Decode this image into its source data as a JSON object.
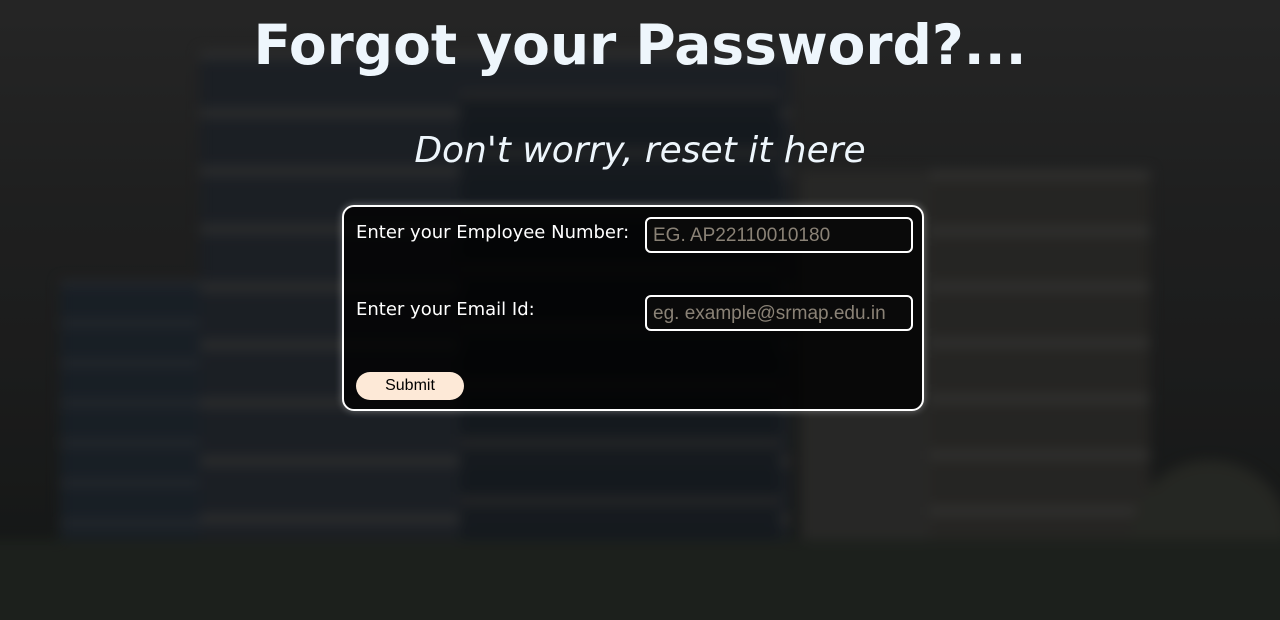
{
  "page": {
    "title": "Forgot your Password?...",
    "subtitle": "Don't worry, reset it here"
  },
  "form": {
    "employee_label": "Enter your Employee Number:",
    "employee_placeholder": "EG. AP22110010180",
    "employee_value": "",
    "email_label": "Enter your Email Id:",
    "email_placeholder": "eg. example@srmap.edu.in",
    "email_value": "",
    "submit_label": "Submit"
  },
  "colors": {
    "heading_text": "#eef6fc",
    "form_border": "#ffffff",
    "form_background": "#000000",
    "placeholder_text": "#8a8276",
    "submit_background": "#fde9d7"
  }
}
